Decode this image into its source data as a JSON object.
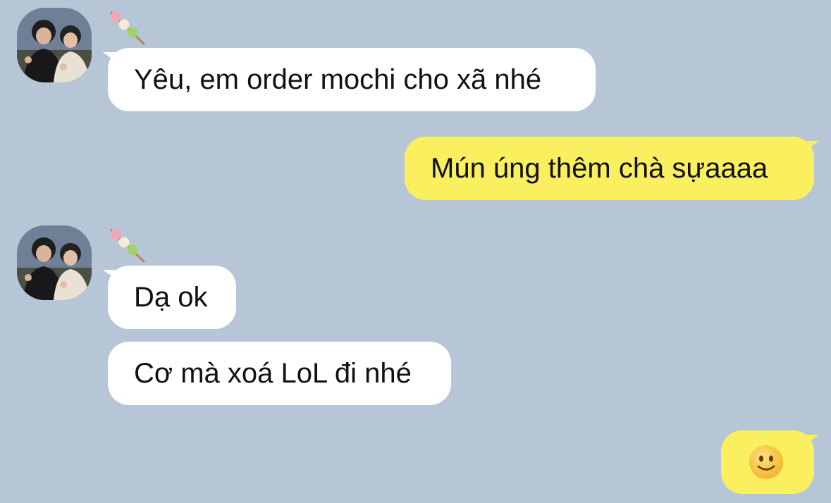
{
  "conversation": {
    "messages": [
      {
        "direction": "incoming",
        "text": "Yêu, em order mochi cho xã nhé"
      },
      {
        "direction": "outgoing",
        "text": "Mún úng thêm chà sựaaaa"
      },
      {
        "direction": "incoming",
        "text": "Dạ ok"
      },
      {
        "direction": "incoming",
        "text": "Cơ mà xoá LoL đi nhé"
      },
      {
        "direction": "outgoing",
        "emoji": "slightly-smiling-face"
      }
    ]
  },
  "sender": {
    "avatar_icon": "couple-photo-avatar",
    "name_icon": "dango-icon"
  },
  "colors": {
    "background": "#b6c6d6",
    "incoming_bubble": "#ffffff",
    "outgoing_bubble": "#f9ef5f"
  }
}
